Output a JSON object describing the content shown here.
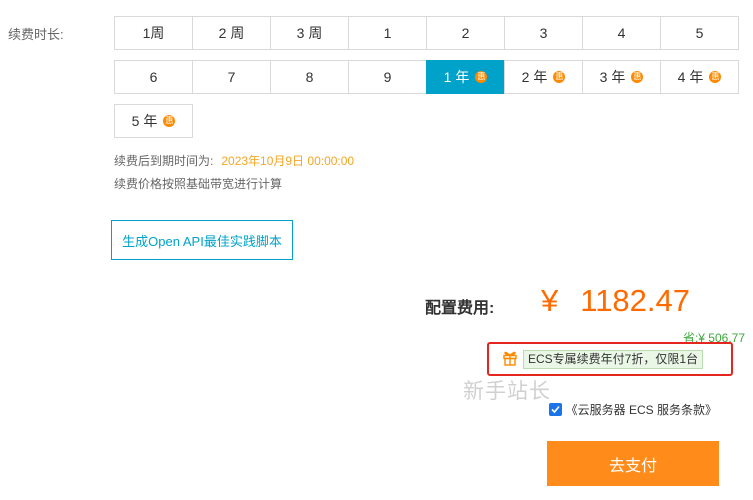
{
  "duration": {
    "label": "续费时长:",
    "row1": [
      {
        "label": "1周"
      },
      {
        "label": "2 周"
      },
      {
        "label": "3 周"
      },
      {
        "label": "1"
      },
      {
        "label": "2"
      },
      {
        "label": "3"
      },
      {
        "label": "4"
      },
      {
        "label": "5"
      }
    ],
    "row2": [
      {
        "label": "6"
      },
      {
        "label": "7"
      },
      {
        "label": "8"
      },
      {
        "label": "9"
      },
      {
        "label": "1 年",
        "selected": true
      },
      {
        "label": "2 年"
      },
      {
        "label": "3 年"
      },
      {
        "label": "4 年"
      }
    ],
    "row3": [
      {
        "label": "5 年"
      }
    ],
    "discount_glyph": "惠"
  },
  "expire": {
    "label": "续费后到期时间为:",
    "date": "2023年10月9日 00:00:00"
  },
  "price_note": "续费价格按照基础带宽进行计算",
  "api_button": "生成Open API最佳实践脚本",
  "fee": {
    "label": "配置费用:",
    "currency": "¥",
    "amount": "1182.47",
    "savings": "省:¥ 506.77"
  },
  "promo": {
    "text": "ECS专属续费年付7折，仅限1台"
  },
  "watermark": "新手站长",
  "agreement": {
    "checked": true,
    "text": "《云服务器 ECS 服务条款》"
  },
  "pay_button": "去支付",
  "colors": {
    "accent": "#00a2ca",
    "price": "#ff6a00",
    "pay": "#ff8c1a",
    "highlight_box": "#e5261f",
    "savings": "#3fa63c"
  }
}
